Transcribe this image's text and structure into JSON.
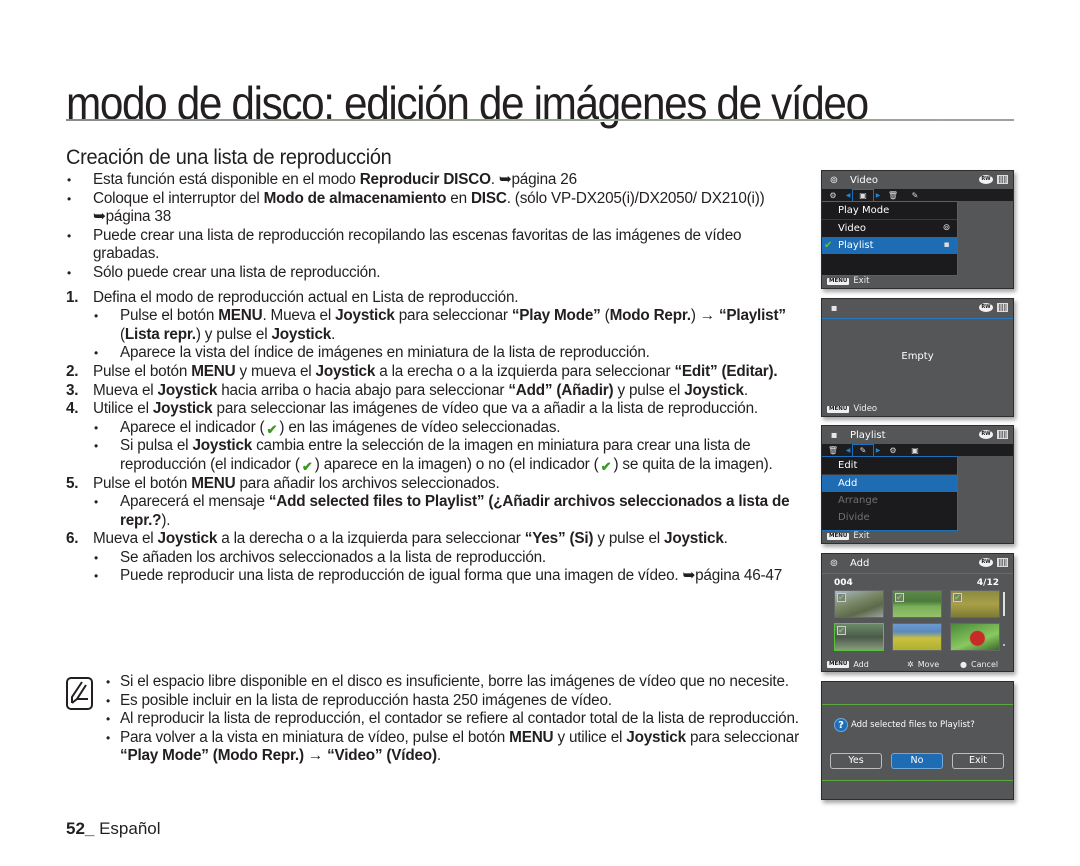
{
  "page": {
    "title": "modo de disco: edición de imágenes de vídeo",
    "subtitle": "Creación de una lista de reproducción",
    "footer_page": "52_",
    "footer_lang": " Español"
  },
  "intro_bullets": [
    [
      "Esta función está disponible en el modo ",
      {
        "b": "Reproducir DISCO"
      },
      ". ➥página 26"
    ],
    [
      "Coloque el interruptor del ",
      {
        "b": "Modo de almacenamiento"
      },
      " en ",
      {
        "b": "DISC"
      },
      ". (sólo VP-DX205(i)/DX2050/ DX210(i)) ➥página 38"
    ],
    [
      "Puede crear una lista de reproducción recopilando las escenas favoritas de las imágenes de vídeo grabadas."
    ],
    [
      "Sólo puede crear una lista de reproducción."
    ]
  ],
  "steps": [
    {
      "n": "1.",
      "text": [
        "Defina el modo de reproducción actual en Lista de reproducción."
      ],
      "subs": [
        [
          "Pulse el botón ",
          {
            "b": "MENU"
          },
          ". Mueva el ",
          {
            "b": "Joystick"
          },
          " para seleccionar ",
          {
            "b": "“Play Mode”"
          },
          " (",
          {
            "b": "Modo Repr."
          },
          ") → ",
          {
            "b": "“Playlist”"
          },
          " (",
          {
            "b": "Lista repr."
          },
          ") y pulse el ",
          {
            "b": "Joystick"
          },
          "."
        ],
        [
          "Aparece la vista del índice de imágenes en miniatura de la lista de reproducción."
        ]
      ]
    },
    {
      "n": "2.",
      "text": [
        "Pulse el botón ",
        {
          "b": "MENU"
        },
        " y mueva el ",
        {
          "b": "Joystick"
        },
        " a la erecha o a la izquierda para seleccionar ",
        {
          "b": "“Edit” (Editar)."
        }
      ],
      "subs": []
    },
    {
      "n": "3.",
      "text": [
        "Mueva el ",
        {
          "b": "Joystick"
        },
        " hacia arriba o hacia abajo para seleccionar ",
        {
          "b": "“Add” (Añadir)"
        },
        " y pulse el ",
        {
          "b": "Joystick"
        },
        "."
      ],
      "subs": []
    },
    {
      "n": "4.",
      "text": [
        "Utilice el ",
        {
          "b": "Joystick"
        },
        " para seleccionar las imágenes de vídeo que va a añadir a la lista de reproducción."
      ],
      "subs": [
        [
          "Aparece el indicador (",
          {
            "ck": "✔"
          },
          ") en las imágenes de vídeo seleccionadas."
        ],
        [
          "Si pulsa el ",
          {
            "b": "Joystick"
          },
          " cambia entre la selección de la imagen en miniatura  para crear una lista de reproducción (el indicador (",
          {
            "ck": "✔"
          },
          ") aparece en la imagen) o no (el indicador (",
          {
            "ck": "✔"
          },
          ") se quita de la imagen)."
        ]
      ]
    },
    {
      "n": "5.",
      "text": [
        "Pulse el botón ",
        {
          "b": "MENU"
        },
        " para añadir los archivos seleccionados."
      ],
      "subs": [
        [
          "Aparecerá el mensaje ",
          {
            "b": "“Add selected files to Playlist” (¿Añadir archivos seleccionados a lista de repr.?"
          },
          ")."
        ]
      ]
    },
    {
      "n": "6.",
      "text": [
        "Mueva el ",
        {
          "b": "Joystick"
        },
        " a la derecha o a la izquierda para seleccionar ",
        {
          "b": "“Yes” (Si)"
        },
        " y pulse el ",
        {
          "b": "Joystick"
        },
        "."
      ],
      "subs": [
        [
          "Se añaden los archivos seleccionados a la lista de reproducción."
        ],
        [
          "Puede reproducir una lista de reproducción de igual forma que una imagen de vídeo. ➥página 46-47"
        ]
      ]
    }
  ],
  "notes": [
    [
      "Si el espacio libre disponible en el disco es insuficiente, borre las imágenes de vídeo que no necesite."
    ],
    [
      "Es posible incluir en la lista de reproducción hasta 250 imágenes de vídeo."
    ],
    [
      "Al reproducir la lista de reproducción, el contador se refiere al contador total de la lista de reproducción."
    ],
    [
      "Para volver a la vista en miniatura de vídeo, pulse el botón ",
      {
        "b": "MENU"
      },
      " y utilice el ",
      {
        "b": "Joystick"
      },
      " para seleccionar ",
      {
        "b": "“Play Mode” (Modo Repr.)"
      },
      " → ",
      {
        "b": "“Video” (Vídeo)"
      },
      "."
    ]
  ],
  "screens": {
    "s1": {
      "header": "Video",
      "menu_title": "Play Mode",
      "items": [
        {
          "label": "Video",
          "icon": "video-mode-icon",
          "selected": false
        },
        {
          "label": "Playlist",
          "icon": "playlist-icon",
          "selected": true,
          "checked": true
        }
      ],
      "footer_key": "MENU",
      "footer_label": "Exit"
    },
    "s2": {
      "message": "Empty",
      "footer_key": "MENU",
      "footer_label": "Video"
    },
    "s3": {
      "header": "Playlist",
      "menu_title": "Edit",
      "items": [
        {
          "label": "Add",
          "selected": true,
          "enabled": true
        },
        {
          "label": "Arrange",
          "selected": false,
          "enabled": false
        },
        {
          "label": "Divide",
          "selected": false,
          "enabled": false
        }
      ],
      "footer_key": "MENU",
      "footer_label": "Exit"
    },
    "s4": {
      "header": "Add",
      "file_no": "004",
      "count": "4/12",
      "thumbnails": [
        {
          "checked": true,
          "current": false,
          "scene": "rocky-cliff"
        },
        {
          "checked": true,
          "current": false,
          "scene": "green-field"
        },
        {
          "checked": true,
          "current": false,
          "scene": "golfer"
        },
        {
          "checked": true,
          "current": true,
          "scene": "hikers"
        },
        {
          "checked": false,
          "current": false,
          "scene": "yellow-flowers"
        },
        {
          "checked": false,
          "current": false,
          "scene": "ladybug"
        }
      ],
      "footer_key": "MENU",
      "footer_add": "Add",
      "footer_move": "Move",
      "footer_cancel": "Cancel"
    },
    "s5": {
      "question": "Add selected files to Playlist?",
      "buttons": [
        "Yes",
        "No",
        "Exit"
      ],
      "selected_button": "No"
    }
  },
  "colors": {
    "screen_bg": "#555658",
    "highlight": "#1e6cb4",
    "check": "#3a9a24"
  }
}
